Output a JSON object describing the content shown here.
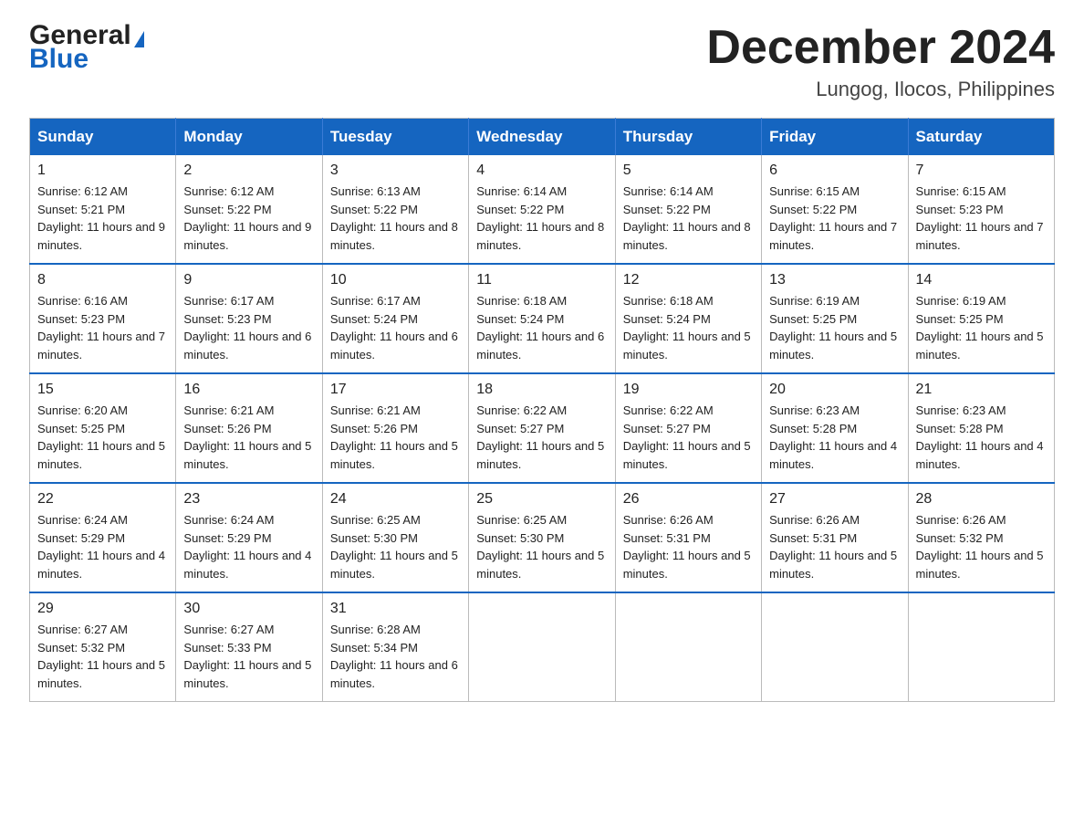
{
  "header": {
    "logo_general": "General",
    "logo_blue": "Blue",
    "month_title": "December 2024",
    "subtitle": "Lungog, Ilocos, Philippines"
  },
  "days_of_week": [
    "Sunday",
    "Monday",
    "Tuesday",
    "Wednesday",
    "Thursday",
    "Friday",
    "Saturday"
  ],
  "weeks": [
    [
      {
        "day": "1",
        "sunrise": "6:12 AM",
        "sunset": "5:21 PM",
        "daylight": "11 hours and 9 minutes."
      },
      {
        "day": "2",
        "sunrise": "6:12 AM",
        "sunset": "5:22 PM",
        "daylight": "11 hours and 9 minutes."
      },
      {
        "day": "3",
        "sunrise": "6:13 AM",
        "sunset": "5:22 PM",
        "daylight": "11 hours and 8 minutes."
      },
      {
        "day": "4",
        "sunrise": "6:14 AM",
        "sunset": "5:22 PM",
        "daylight": "11 hours and 8 minutes."
      },
      {
        "day": "5",
        "sunrise": "6:14 AM",
        "sunset": "5:22 PM",
        "daylight": "11 hours and 8 minutes."
      },
      {
        "day": "6",
        "sunrise": "6:15 AM",
        "sunset": "5:22 PM",
        "daylight": "11 hours and 7 minutes."
      },
      {
        "day": "7",
        "sunrise": "6:15 AM",
        "sunset": "5:23 PM",
        "daylight": "11 hours and 7 minutes."
      }
    ],
    [
      {
        "day": "8",
        "sunrise": "6:16 AM",
        "sunset": "5:23 PM",
        "daylight": "11 hours and 7 minutes."
      },
      {
        "day": "9",
        "sunrise": "6:17 AM",
        "sunset": "5:23 PM",
        "daylight": "11 hours and 6 minutes."
      },
      {
        "day": "10",
        "sunrise": "6:17 AM",
        "sunset": "5:24 PM",
        "daylight": "11 hours and 6 minutes."
      },
      {
        "day": "11",
        "sunrise": "6:18 AM",
        "sunset": "5:24 PM",
        "daylight": "11 hours and 6 minutes."
      },
      {
        "day": "12",
        "sunrise": "6:18 AM",
        "sunset": "5:24 PM",
        "daylight": "11 hours and 5 minutes."
      },
      {
        "day": "13",
        "sunrise": "6:19 AM",
        "sunset": "5:25 PM",
        "daylight": "11 hours and 5 minutes."
      },
      {
        "day": "14",
        "sunrise": "6:19 AM",
        "sunset": "5:25 PM",
        "daylight": "11 hours and 5 minutes."
      }
    ],
    [
      {
        "day": "15",
        "sunrise": "6:20 AM",
        "sunset": "5:25 PM",
        "daylight": "11 hours and 5 minutes."
      },
      {
        "day": "16",
        "sunrise": "6:21 AM",
        "sunset": "5:26 PM",
        "daylight": "11 hours and 5 minutes."
      },
      {
        "day": "17",
        "sunrise": "6:21 AM",
        "sunset": "5:26 PM",
        "daylight": "11 hours and 5 minutes."
      },
      {
        "day": "18",
        "sunrise": "6:22 AM",
        "sunset": "5:27 PM",
        "daylight": "11 hours and 5 minutes."
      },
      {
        "day": "19",
        "sunrise": "6:22 AM",
        "sunset": "5:27 PM",
        "daylight": "11 hours and 5 minutes."
      },
      {
        "day": "20",
        "sunrise": "6:23 AM",
        "sunset": "5:28 PM",
        "daylight": "11 hours and 4 minutes."
      },
      {
        "day": "21",
        "sunrise": "6:23 AM",
        "sunset": "5:28 PM",
        "daylight": "11 hours and 4 minutes."
      }
    ],
    [
      {
        "day": "22",
        "sunrise": "6:24 AM",
        "sunset": "5:29 PM",
        "daylight": "11 hours and 4 minutes."
      },
      {
        "day": "23",
        "sunrise": "6:24 AM",
        "sunset": "5:29 PM",
        "daylight": "11 hours and 4 minutes."
      },
      {
        "day": "24",
        "sunrise": "6:25 AM",
        "sunset": "5:30 PM",
        "daylight": "11 hours and 5 minutes."
      },
      {
        "day": "25",
        "sunrise": "6:25 AM",
        "sunset": "5:30 PM",
        "daylight": "11 hours and 5 minutes."
      },
      {
        "day": "26",
        "sunrise": "6:26 AM",
        "sunset": "5:31 PM",
        "daylight": "11 hours and 5 minutes."
      },
      {
        "day": "27",
        "sunrise": "6:26 AM",
        "sunset": "5:31 PM",
        "daylight": "11 hours and 5 minutes."
      },
      {
        "day": "28",
        "sunrise": "6:26 AM",
        "sunset": "5:32 PM",
        "daylight": "11 hours and 5 minutes."
      }
    ],
    [
      {
        "day": "29",
        "sunrise": "6:27 AM",
        "sunset": "5:32 PM",
        "daylight": "11 hours and 5 minutes."
      },
      {
        "day": "30",
        "sunrise": "6:27 AM",
        "sunset": "5:33 PM",
        "daylight": "11 hours and 5 minutes."
      },
      {
        "day": "31",
        "sunrise": "6:28 AM",
        "sunset": "5:34 PM",
        "daylight": "11 hours and 6 minutes."
      },
      null,
      null,
      null,
      null
    ]
  ]
}
